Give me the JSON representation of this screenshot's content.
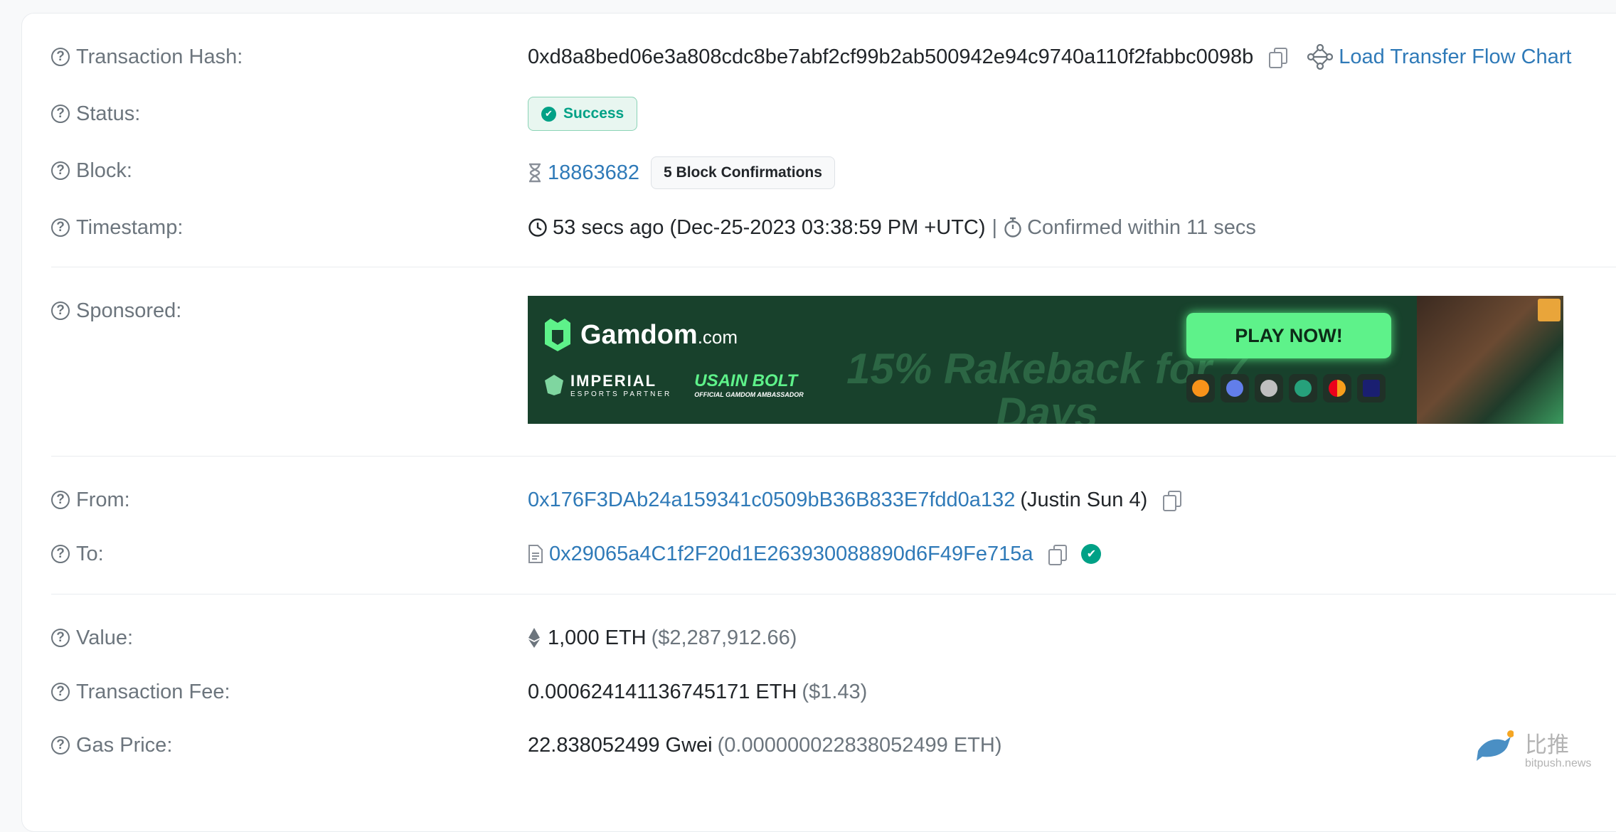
{
  "details": {
    "tx_hash": {
      "label": "Transaction Hash:",
      "value": "0xd8a8bed06e3a808cdc8be7abf2cf99b2ab500942e94c9740a110f2fabbc0098b",
      "flow_chart_link": "Load Transfer Flow Chart"
    },
    "status": {
      "label": "Status:",
      "value": "Success"
    },
    "block": {
      "label": "Block:",
      "number": "18863682",
      "confirmations": "5 Block Confirmations"
    },
    "timestamp": {
      "label": "Timestamp:",
      "value": "53 secs ago (Dec-25-2023 03:38:59 PM +UTC)",
      "separator": "|",
      "confirmed": "Confirmed within 11 secs"
    },
    "sponsored": {
      "label": "Sponsored:"
    },
    "from": {
      "label": "From:",
      "address": "0x176F3DAb24a159341c0509bB36B833E7fdd0a132",
      "name": "(Justin Sun 4)"
    },
    "to": {
      "label": "To:",
      "address": "0x29065a4C1f2F20d1E263930088890d6F49Fe715a"
    },
    "value": {
      "label": "Value:",
      "amount": "1,000 ETH",
      "usd": "($2,287,912.66)"
    },
    "fee": {
      "label": "Transaction Fee:",
      "amount": "0.000624141136745171 ETH",
      "usd": "($1.43)"
    },
    "gas": {
      "label": "Gas Price:",
      "amount": "22.838052499 Gwei",
      "eth": "(0.000000022838052499 ETH)"
    }
  },
  "ad": {
    "brand": "Gamdom",
    "brand_suffix": ".com",
    "partner_1": "IMPERIAL",
    "partner_1_sub": "ESPORTS PARTNER",
    "partner_2": "USAIN BOLT",
    "partner_2_sub": "OFFICIAL GAMDOM AMBASSADOR",
    "headline": "15% Rakeback for 7 Days",
    "cta": "PLAY NOW!",
    "payment_icons": [
      "bitcoin-icon",
      "ethereum-icon",
      "litecoin-icon",
      "tether-icon",
      "mastercard-icon",
      "visa-icon"
    ]
  },
  "watermark": {
    "cn": "比推",
    "site": "bitpush.news"
  },
  "colors": {
    "link": "#2f7ab8",
    "success": "#00a186",
    "ad_bg": "#18412c",
    "cta": "#5ef28a"
  }
}
